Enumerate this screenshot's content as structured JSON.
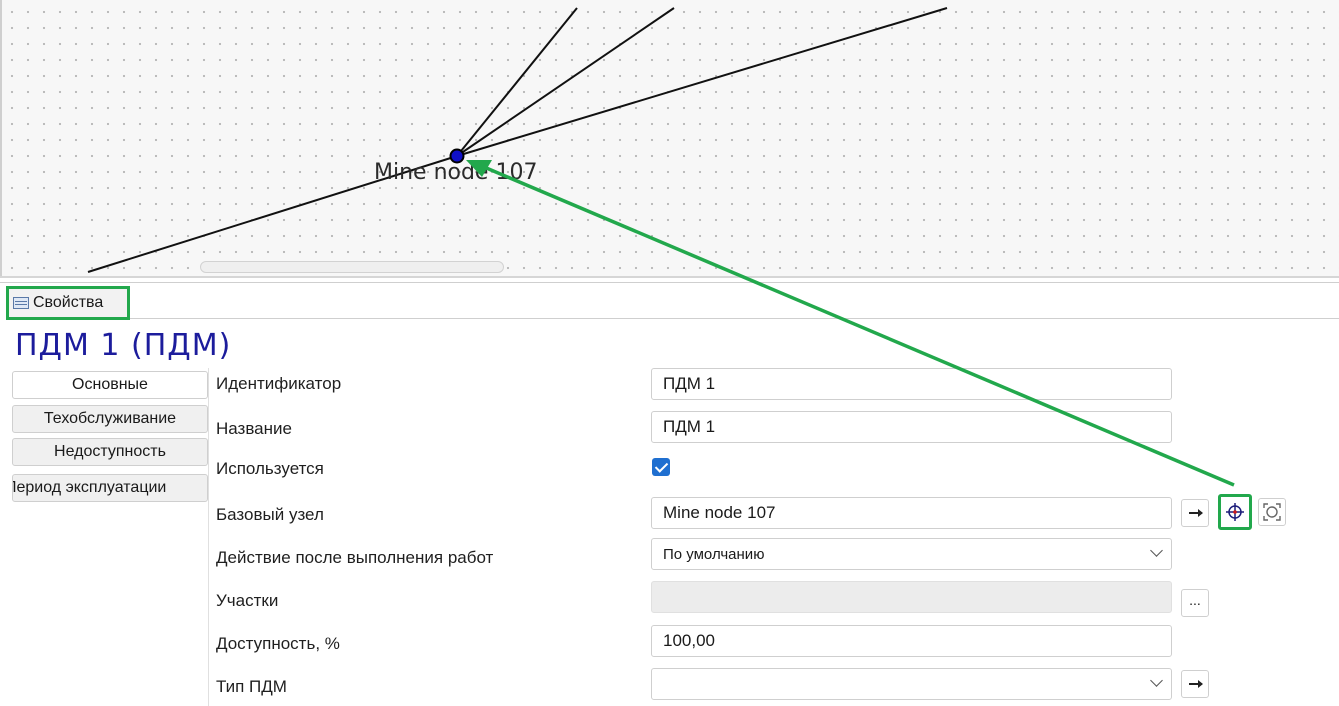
{
  "canvas": {
    "node_label": "Mine node 107"
  },
  "panel": {
    "tab_label": "Свойства",
    "object_title": "ПДМ 1 (ПДМ)"
  },
  "side_tabs": [
    "Основные",
    "Техобслуживание",
    "Недоступность",
    "Период эксплуатации"
  ],
  "properties": {
    "identifier": {
      "label": "Идентификатор",
      "value": "ПДМ 1"
    },
    "name": {
      "label": "Название",
      "value": "ПДМ 1"
    },
    "used": {
      "label": "Используется",
      "checked": true
    },
    "base_node": {
      "label": "Базовый узел",
      "value": "Mine node 107"
    },
    "after_work_action": {
      "label": "Действие после выполнения работ",
      "value": "По умолчанию"
    },
    "sections": {
      "label": "Участки",
      "value": "",
      "button": "..."
    },
    "availability": {
      "label": "Доступность, %",
      "value": "100,00"
    },
    "pdm_type": {
      "label": "Тип ПДМ",
      "value": ""
    }
  },
  "icons": {
    "panel_tab": "properties-table-icon",
    "goto": "arrow-right-icon",
    "locate": "crosshair-target-icon",
    "zoom_fit": "zoom-fit-icon"
  },
  "colors": {
    "highlight": "#22a84c",
    "title": "#1c1c9c",
    "node": "#1010c8",
    "checkbox": "#1f6fd0"
  }
}
